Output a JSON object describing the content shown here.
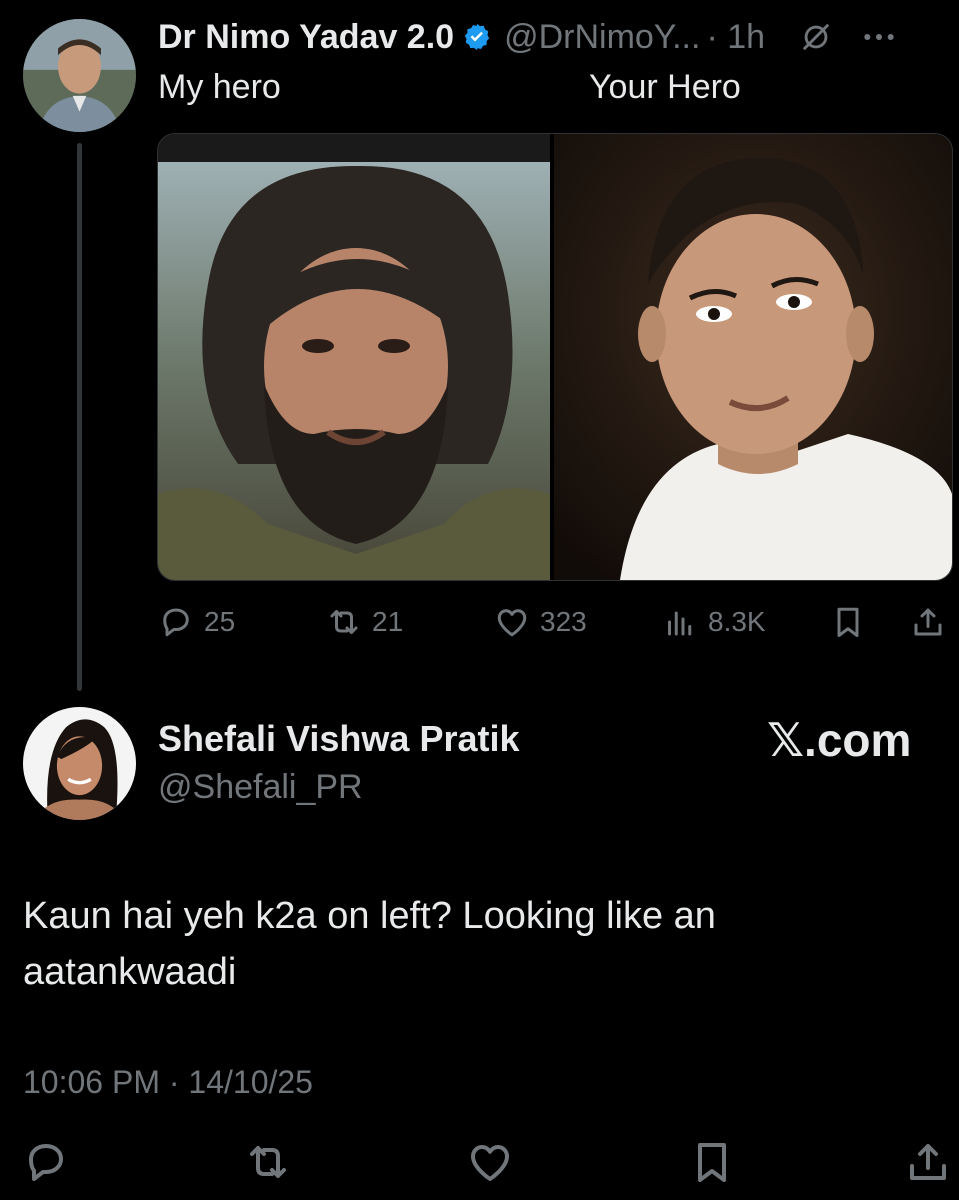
{
  "quoted_tweet": {
    "author_name": "Dr Nimo Yadav 2.0",
    "handle": "@DrNimoY...",
    "time": "· 1h",
    "text_left": "My hero",
    "text_right": "Your Hero",
    "actions": {
      "replies": "25",
      "reposts": "21",
      "likes": "323",
      "views": "8.3K"
    }
  },
  "tweet": {
    "author_name": "Shefali Vishwa Pratik",
    "handle": "@Shefali_PR",
    "brand": "𝕏.com",
    "body": "Kaun hai yeh k2a on left? Looking like an aatankwaadi",
    "timestamp": "10:06 PM · 14/10/25"
  },
  "icons": {
    "verified": "verified-badge-icon",
    "grok": "grok-icon",
    "more": "more-icon",
    "reply": "reply-icon",
    "repost": "repost-icon",
    "like": "like-icon",
    "views": "views-icon",
    "bookmark": "bookmark-icon",
    "share": "share-icon"
  },
  "colors": {
    "background": "#000000",
    "text_primary": "#e7e9ea",
    "text_secondary": "#71767b",
    "verified": "#1d9bf0"
  }
}
